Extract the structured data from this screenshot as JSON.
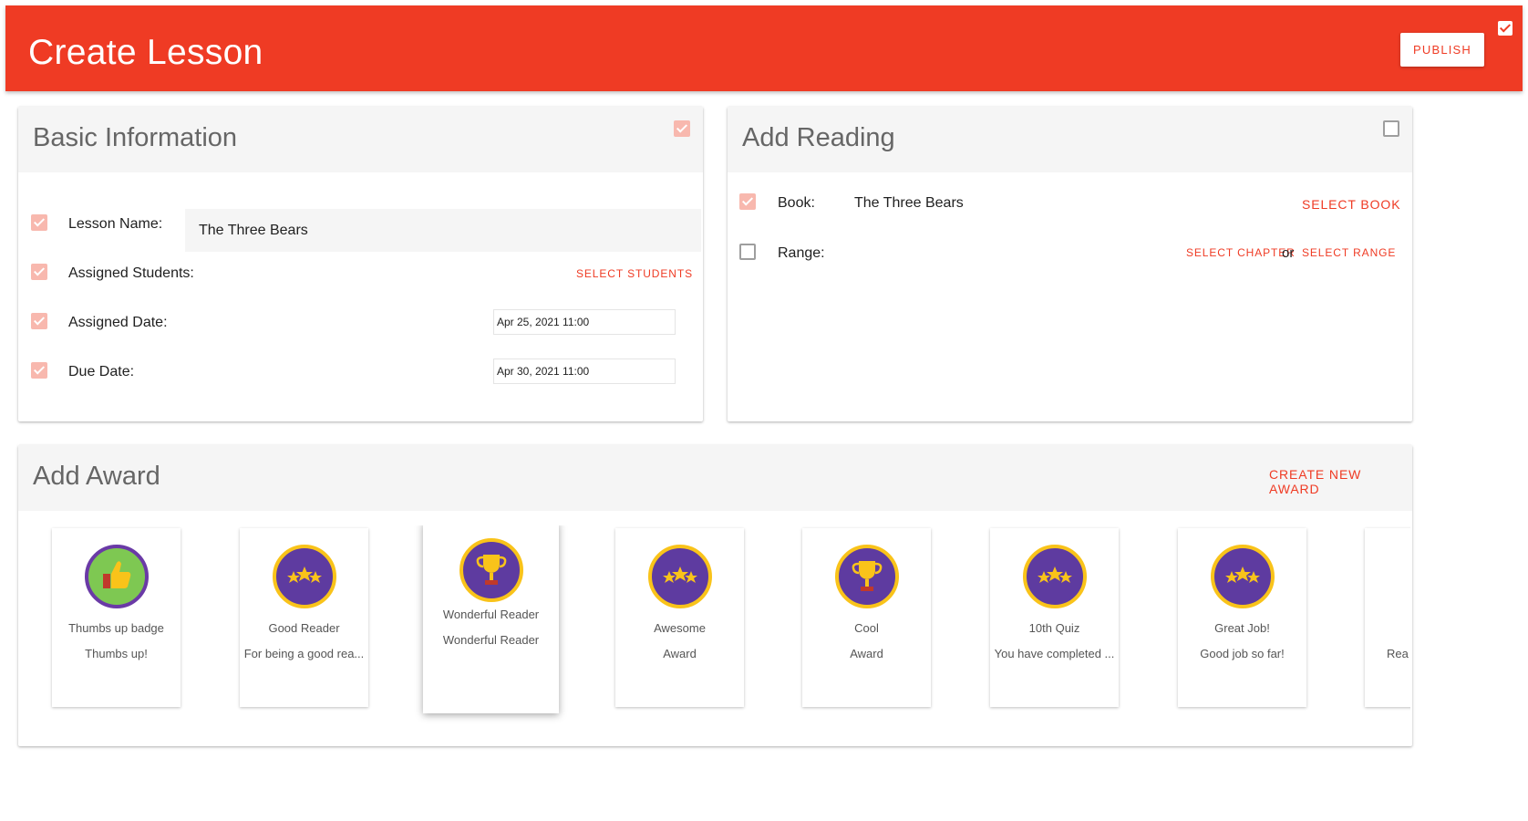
{
  "header": {
    "title": "Create Lesson",
    "publish_label": "PUBLISH",
    "accent_color": "#ef3b24"
  },
  "basic_info": {
    "title": "Basic Information",
    "lesson_name_label": "Lesson Name:",
    "lesson_name_value": "The Three Bears",
    "assigned_students_label": "Assigned Students:",
    "select_students_label": "SELECT STUDENTS",
    "assigned_date_label": "Assigned Date:",
    "assigned_date_value": "Apr 25, 2021 11:00",
    "due_date_label": "Due Date:",
    "due_date_value": "Apr 30, 2021 11:00"
  },
  "add_reading": {
    "title": "Add Reading",
    "book_label": "Book:",
    "book_value": "The Three Bears",
    "select_book_label": "SELECT BOOK",
    "range_label": "Range:",
    "select_chapter_label": "SELECT CHAPTER",
    "or_label": "or",
    "select_range_label": "SELECT RANGE"
  },
  "add_award": {
    "title": "Add Award",
    "create_new_label": "CREATE NEW AWARD",
    "awards": [
      {
        "name": "Thumbs up badge",
        "desc": "Thumbs up!",
        "icon": "thumbs-up-icon"
      },
      {
        "name": "Good Reader",
        "desc": "For being a good rea...",
        "icon": "stars-icon"
      },
      {
        "name": "Wonderful Reader",
        "desc": "Wonderful Reader",
        "icon": "trophy-icon",
        "selected": true
      },
      {
        "name": "Awesome",
        "desc": "Award",
        "icon": "stars-icon"
      },
      {
        "name": "Cool",
        "desc": "Award",
        "icon": "trophy-icon"
      },
      {
        "name": "10th Quiz",
        "desc": "You have completed ...",
        "icon": "stars-icon"
      },
      {
        "name": "Great Job!",
        "desc": "Good job so far!",
        "icon": "stars-icon"
      },
      {
        "name": "",
        "desc": "Rea",
        "icon": ""
      }
    ]
  }
}
